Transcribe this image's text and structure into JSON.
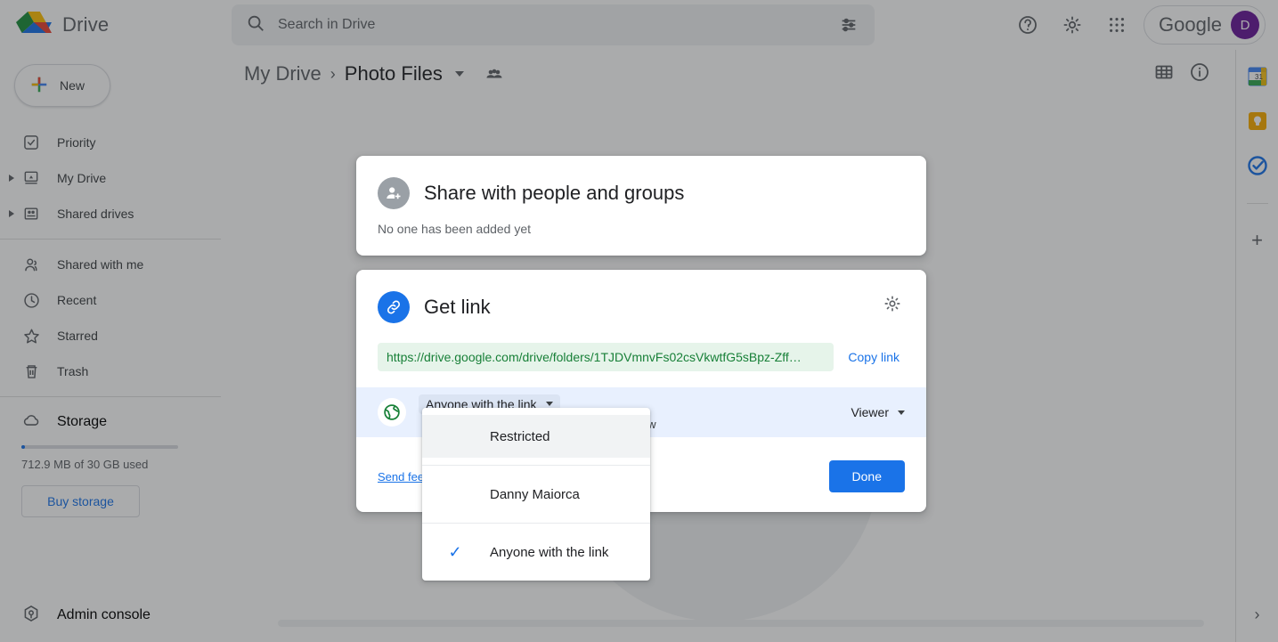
{
  "header": {
    "brand": "Drive",
    "search_placeholder": "Search in Drive",
    "search_value": "",
    "search_icon": "search-icon",
    "tune_icon": "tune-icon",
    "help_icon": "help-icon",
    "settings_icon": "gear-icon",
    "apps_icon": "apps-grid-icon",
    "account_word": "Google",
    "avatar_initial": "D"
  },
  "sidebar": {
    "new_label": "New",
    "items": [
      {
        "label": "Priority",
        "icon": "priority-check-icon",
        "expandable": false
      },
      {
        "label": "My Drive",
        "icon": "my-drive-icon",
        "expandable": true
      },
      {
        "label": "Shared drives",
        "icon": "shared-drives-icon",
        "expandable": true
      },
      {
        "label": "Shared with me",
        "icon": "people-icon",
        "expandable": false
      },
      {
        "label": "Recent",
        "icon": "clock-icon",
        "expandable": false
      },
      {
        "label": "Starred",
        "icon": "star-icon",
        "expandable": false
      },
      {
        "label": "Trash",
        "icon": "trash-icon",
        "expandable": false
      }
    ],
    "storage_label": "Storage",
    "storage_used_text": "712.9 MB of 30 GB used",
    "storage_percent": 2.3,
    "buy_storage_label": "Buy storage",
    "admin_console_label": "Admin console"
  },
  "breadcrumb": {
    "root": "My Drive",
    "separator": "›",
    "current": "Photo Files",
    "people_icon": "people-group-icon",
    "grid_view_icon": "grid-view-icon",
    "info_icon": "info-icon"
  },
  "rail": {
    "items": [
      {
        "name": "calendar-icon",
        "glyph": "31"
      },
      {
        "name": "keep-icon",
        "glyph": ""
      },
      {
        "name": "tasks-icon",
        "glyph": ""
      }
    ],
    "add_label": "+",
    "expand_glyph": "›"
  },
  "dialog": {
    "people": {
      "icon": "person-add-icon",
      "title": "Share with people and groups",
      "subtitle": "No one has been added yet"
    },
    "get_link": {
      "icon": "link-icon",
      "title": "Get link",
      "settings_icon": "gear-icon",
      "url": "https://drive.google.com/drive/folders/1TJDVmnvFs02csVkwtfG5sBpz-Zff…",
      "copy_label": "Copy link",
      "globe_icon": "globe-icon",
      "access_label": "Anyone with the link",
      "access_description": "Anyone on the internet with this link can view",
      "role_label": "Viewer",
      "feedback_label": "Send feedback",
      "done_label": "Done"
    },
    "dropdown": {
      "options": [
        {
          "label": "Restricted",
          "checked": false,
          "hovered": true
        },
        {
          "label": "Danny Maiorca",
          "checked": false,
          "hovered": false
        },
        {
          "label": "Anyone with the link",
          "checked": true,
          "hovered": false
        }
      ],
      "check_glyph": "✓"
    }
  },
  "colors": {
    "accent_blue": "#1a73e8",
    "link_green": "#188038",
    "link_pill_bg": "#e6f4ea",
    "access_row_bg": "#e8f0fe",
    "avatar_purple": "#6a1b9a"
  }
}
